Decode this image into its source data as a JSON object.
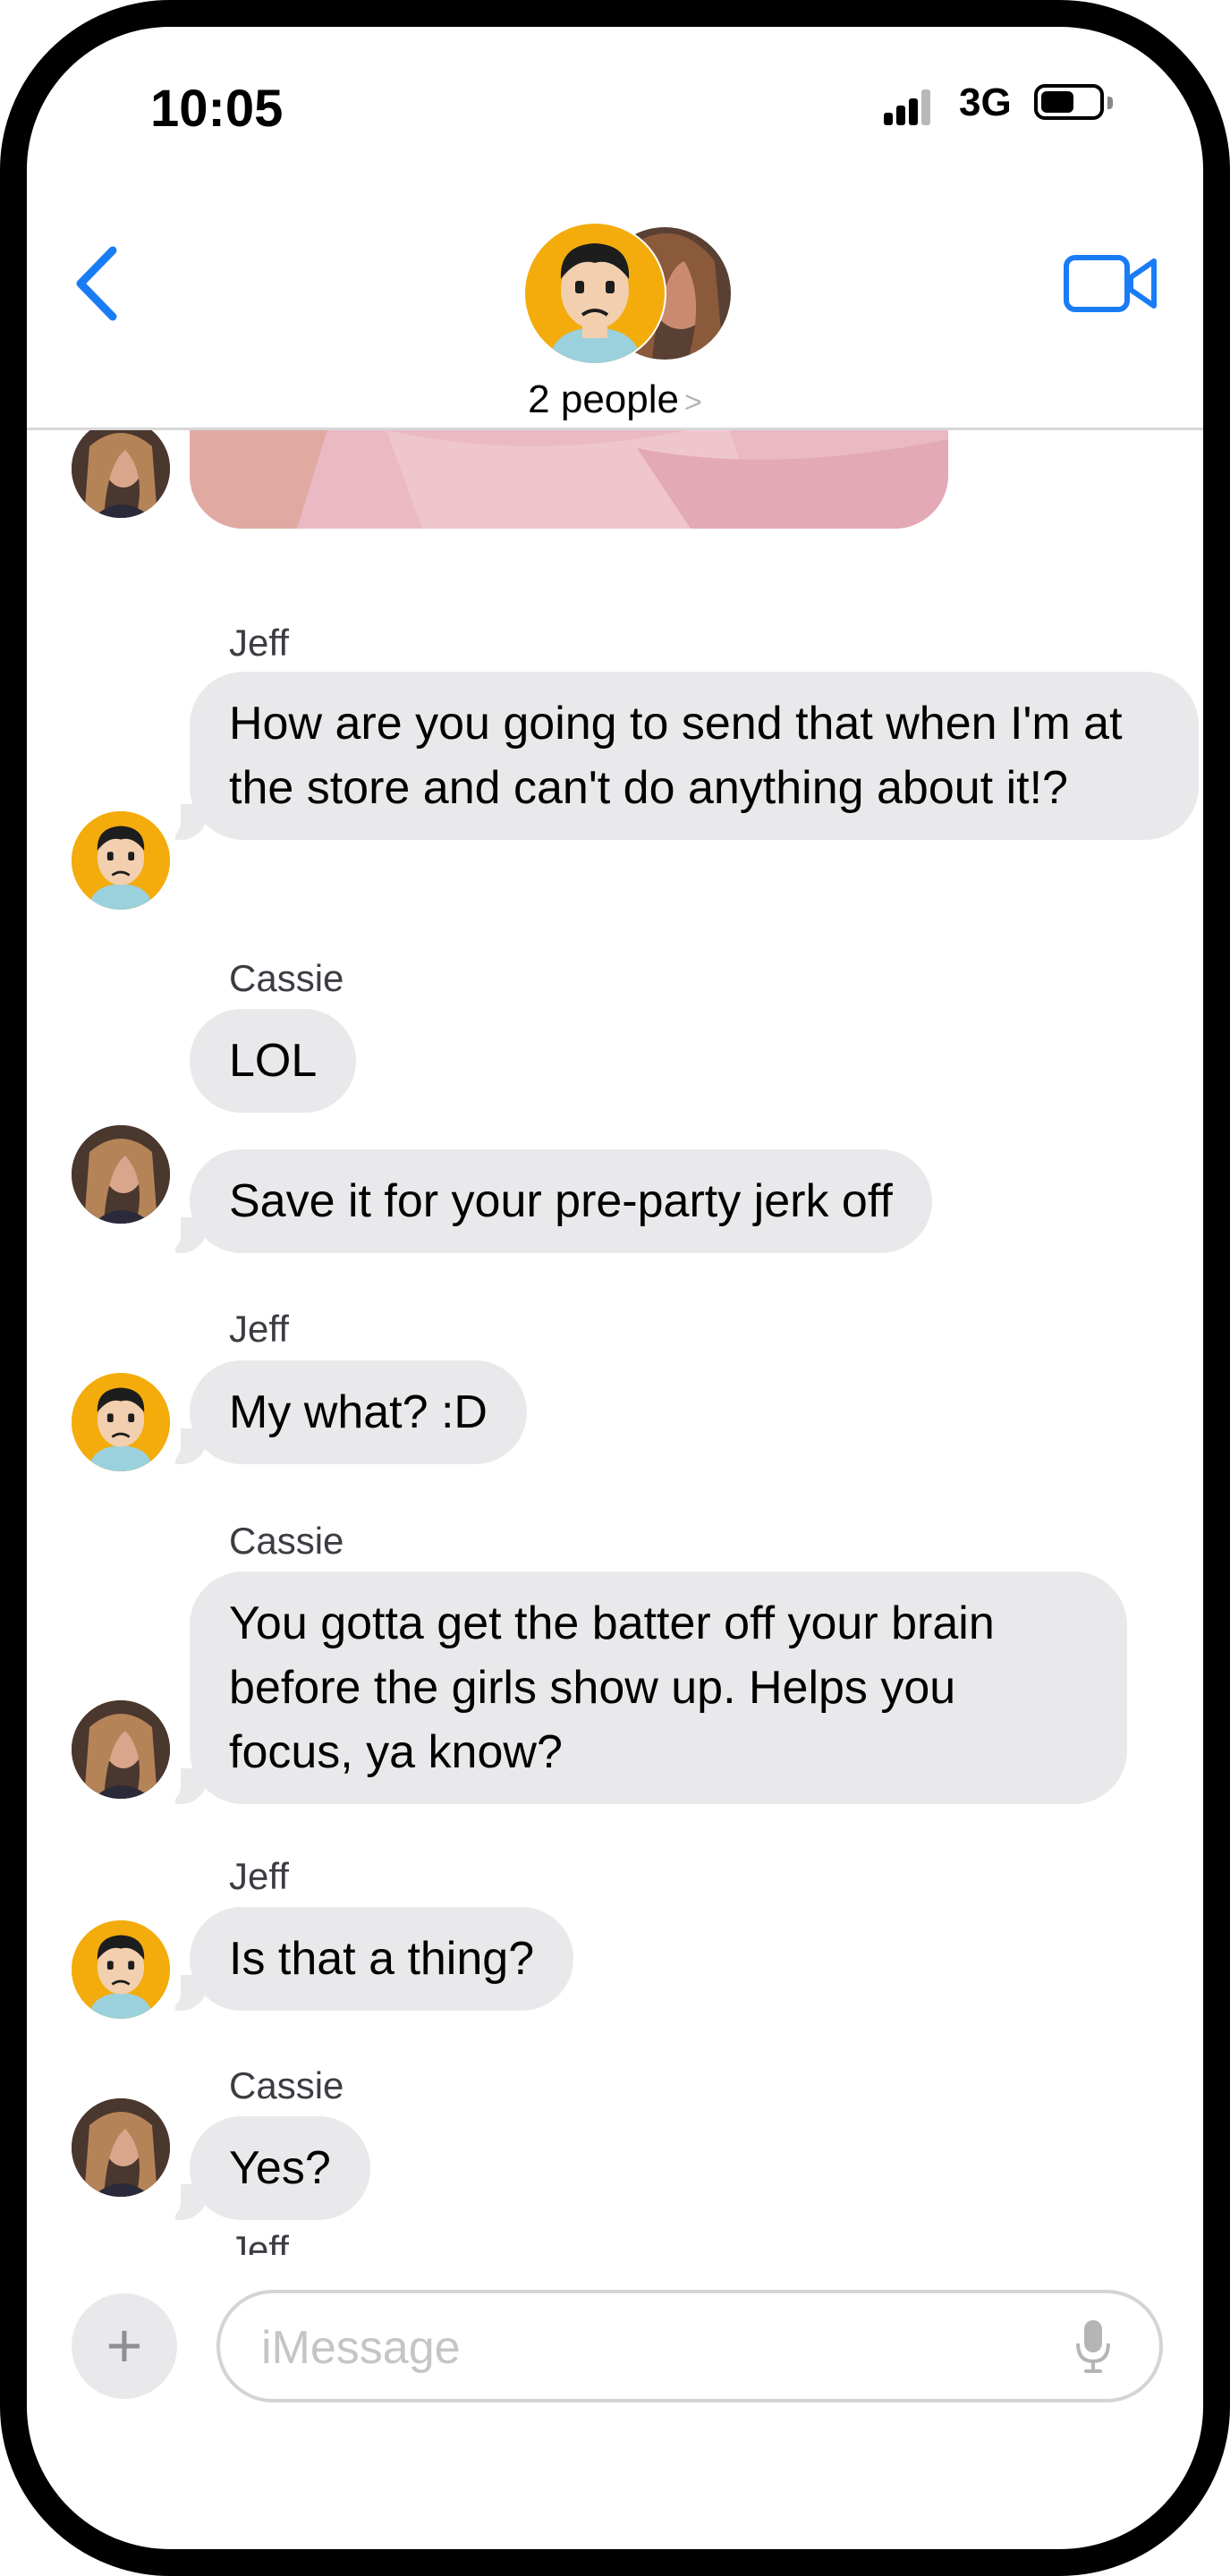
{
  "status_bar": {
    "time": "10:05",
    "network": "3G"
  },
  "header": {
    "back_icon": "chevron-left-icon",
    "video_icon": "video-camera-icon",
    "title": "2 people",
    "title_chevron": ">",
    "accent": "#1a7cf5"
  },
  "messages": [
    {
      "sender": "Jeff",
      "text": "How are you going to send that when I'm at the store and can't do anything about it!?"
    },
    {
      "sender": "Cassie",
      "text": "LOL"
    },
    {
      "sender": "Cassie",
      "text": "Save it for your pre-party jerk off"
    },
    {
      "sender": "Jeff",
      "text": "My what?  :D"
    },
    {
      "sender": "Cassie",
      "text": "You gotta get the batter off your brain before the girls show up.  Helps you focus, ya know?"
    },
    {
      "sender": "Jeff",
      "text": "Is that a thing?"
    },
    {
      "sender": "Cassie",
      "text": "Yes?"
    },
    {
      "sender": "Jeff",
      "text": ""
    }
  ],
  "composer": {
    "placeholder": "iMessage",
    "value": "",
    "plus_label": "+"
  },
  "colors": {
    "bubble": "#e9e9eb",
    "jeff_avatar": "#f3ac0c",
    "frame": "#000000"
  }
}
